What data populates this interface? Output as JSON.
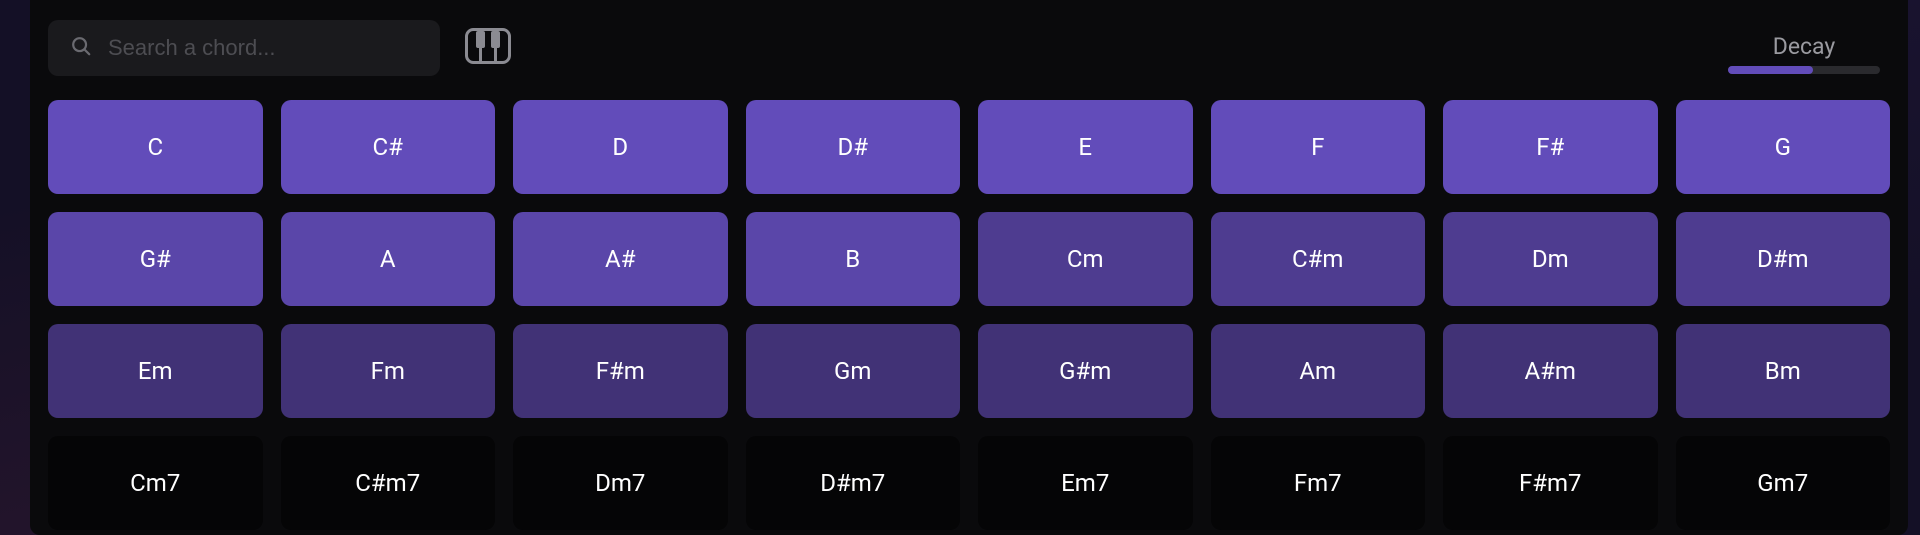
{
  "toolbar": {
    "search_placeholder": "Search a chord...",
    "decay_label": "Decay",
    "decay_value_percent": 56
  },
  "chord_rows": [
    {
      "shade": 0,
      "items": [
        "C",
        "C#",
        "D",
        "D#",
        "E",
        "F",
        "F#",
        "G"
      ]
    },
    {
      "shade": 1,
      "items": [
        "G#",
        "A",
        "A#",
        "B",
        "Cm",
        "C#m",
        "Dm",
        "D#m"
      ],
      "shade_split_index": 4,
      "shade_after": 2
    },
    {
      "shade": 3,
      "items": [
        "Em",
        "Fm",
        "F#m",
        "Gm",
        "G#m",
        "Am",
        "A#m",
        "Bm"
      ]
    },
    {
      "shade": 4,
      "items": [
        "Cm7",
        "C#m7",
        "Dm7",
        "D#m7",
        "Em7",
        "Fm7",
        "F#m7",
        "Gm7"
      ]
    }
  ]
}
